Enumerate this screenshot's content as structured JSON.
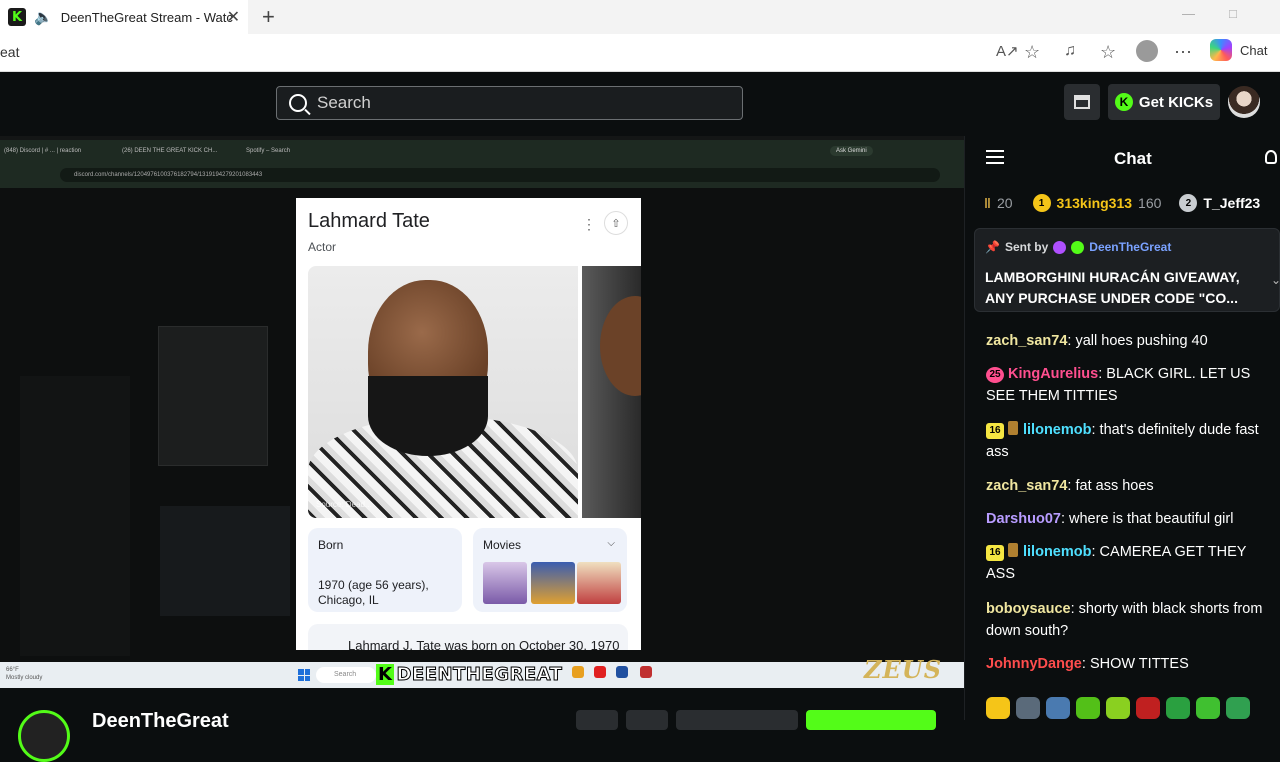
{
  "browser": {
    "tab_title": "DeenTheGreat Stream - Watc",
    "url_fragment": "eat",
    "copilot_label": "Chat"
  },
  "header": {
    "search_placeholder": "Search",
    "get_kicks_label": "Get KICKs"
  },
  "stream": {
    "inner_tabs": [
      "(848) Discord | # ... | reaction",
      "(26) DEEN THE GREAT KICK CH...",
      "Spotify – Search"
    ],
    "inner_url": "discord.com/channels/1204976100376182794/1319194279201083443",
    "ask_gemini": "Ask Gemini",
    "knowledge_card": {
      "name": "Lahmard Tate",
      "role": "Actor",
      "photo_source": "Source: Dead...",
      "born_label": "Born",
      "born_value": "1970 (age 56 years),\nChicago, IL",
      "movies_label": "Movies",
      "bio_snippet": "Lahmard J. Tate was born on October 30, 1970"
    },
    "taskbar": {
      "weather_temp": "66°F",
      "weather_desc": "Mostly cloudy",
      "search_label": "Search",
      "overlay_text": "DEENTHEGREAT",
      "overlay_k": "K",
      "sponsor": "ZEUS"
    }
  },
  "channel": {
    "name": "DeenTheGreat"
  },
  "chat": {
    "title": "Chat",
    "leaderboard": [
      {
        "rank": "",
        "name": "",
        "score": "20",
        "color": "#9a9ea3"
      },
      {
        "rank": "1",
        "name": "313king313",
        "score": "160",
        "color": "#f5c518"
      },
      {
        "rank": "2",
        "name": "T_Jeff23",
        "score": "",
        "color": "#c9cdd1"
      }
    ],
    "pinned": {
      "sent_by": "Sent by",
      "sender": "DeenTheGreat",
      "message": "LAMBORGHINI HURACÁN GIVEAWAY, ANY PURCHASE UNDER CODE \"CO..."
    },
    "messages": [
      {
        "user": "zach_san74",
        "color": "#f0e6a0",
        "text": "yall hoes pushing 40",
        "badge": ""
      },
      {
        "user": "KingAurelius",
        "color": "#ff4f8f",
        "text": "BLACK GIRL. LET US SEE THEM TITTIES",
        "badge": "25"
      },
      {
        "user": "lilonemob",
        "color": "#4fe0ff",
        "text": "that's definitely dude fast ass",
        "badge": "16"
      },
      {
        "user": "zach_san74",
        "color": "#f0e6a0",
        "text": "fat ass hoes",
        "badge": ""
      },
      {
        "user": "Darshuo07",
        "color": "#b89cff",
        "text": "where is that beautiful girl",
        "badge": ""
      },
      {
        "user": "lilonemob",
        "color": "#4fe0ff",
        "text": "CAMEREA GET THEY ASS",
        "badge": "16"
      },
      {
        "user": "boboysauce",
        "color": "#f0e6a0",
        "text": "shorty with black shorts from down south?",
        "badge": ""
      },
      {
        "user": "JohnnyDange",
        "color": "#ff4d4d",
        "text": "SHOW TITTES",
        "badge": ""
      }
    ]
  }
}
